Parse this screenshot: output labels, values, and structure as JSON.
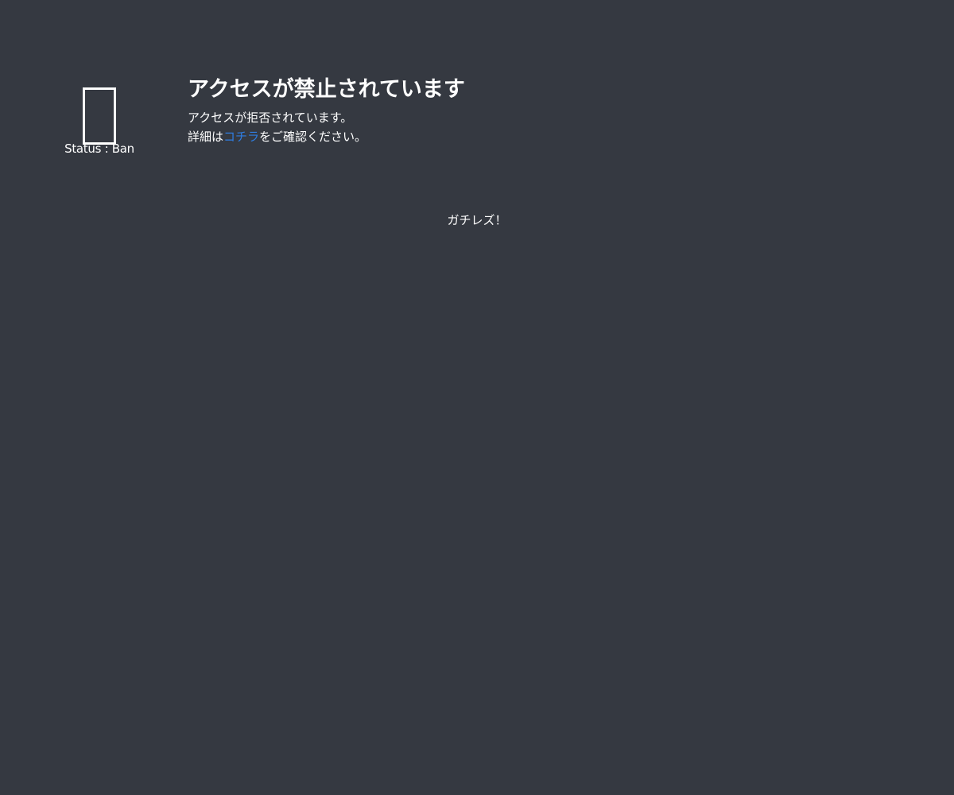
{
  "status": {
    "icon": "ban-icon",
    "text": "Status : Ban"
  },
  "message": {
    "title": "アクセスが禁止されています",
    "line1": "アクセスが拒否されています。",
    "line2_prefix": "詳細は",
    "link_label": "コチラ",
    "line2_suffix": "をご確認ください。"
  },
  "footer": {
    "brand": "ガチレズ！"
  },
  "colors": {
    "background": "#353941",
    "text": "#ffffff",
    "link": "#2f7de1"
  }
}
